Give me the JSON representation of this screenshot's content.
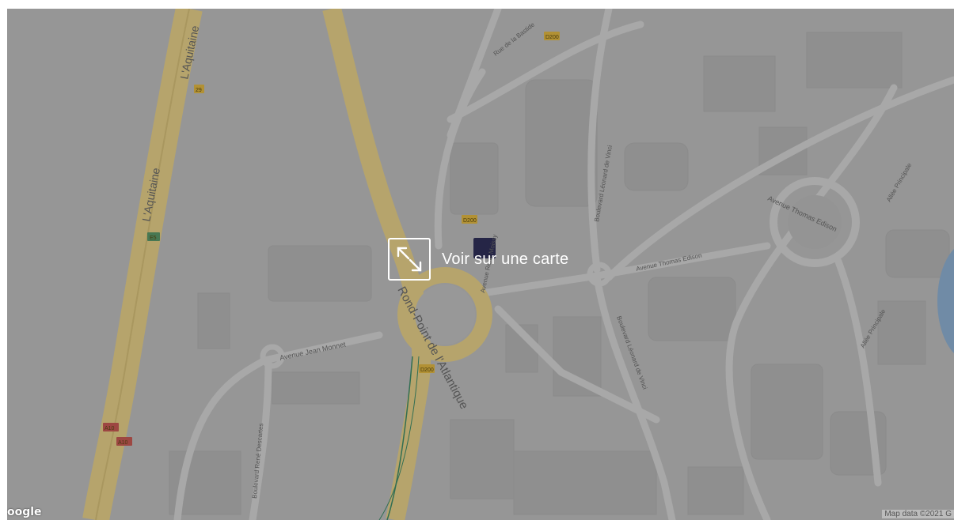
{
  "map": {
    "labels": {
      "aquitaine_north": "L'Aquitaine",
      "aquitaine_south": "L'Aquitaine",
      "rue_bastide": "Rue de la Bastide",
      "jean_monnet": "Avenue Jean Monnet",
      "rond_point": "Rond-Point de l'Atlantique",
      "thomas_edison_east": "Avenue Thomas Edison",
      "thomas_edison_west": "Avenue Thomas Edison",
      "leonard_vinci_north": "Boulevard Léonard de Vinci",
      "leonard_vinci_south": "Boulevard Léonard de Vinci",
      "rene_descartes": "Boulevard René Descartes",
      "allee_principale_north": "Allée Principale",
      "allee_principale_south": "Allée Principale",
      "avenue_moissy": "Avenue René Moissy"
    },
    "shields": {
      "d200_top": "D200",
      "d200_mid": "D200",
      "d200_bottom": "D200",
      "r29": "29",
      "e5": "E5",
      "a10_1": "A10",
      "a10_2": "A10"
    },
    "colors": {
      "background": "#b0b0b0",
      "highway": "#d9c27a",
      "road": "#c6c6c6",
      "building": "#a9a9a9",
      "water": "#7fa2c4",
      "trail": "#2f7d5a"
    }
  },
  "cta": {
    "label": "Voir sur une carte",
    "icon": "expand-icon"
  },
  "attribution": "Map data ©2021 G",
  "logo": "oogle"
}
